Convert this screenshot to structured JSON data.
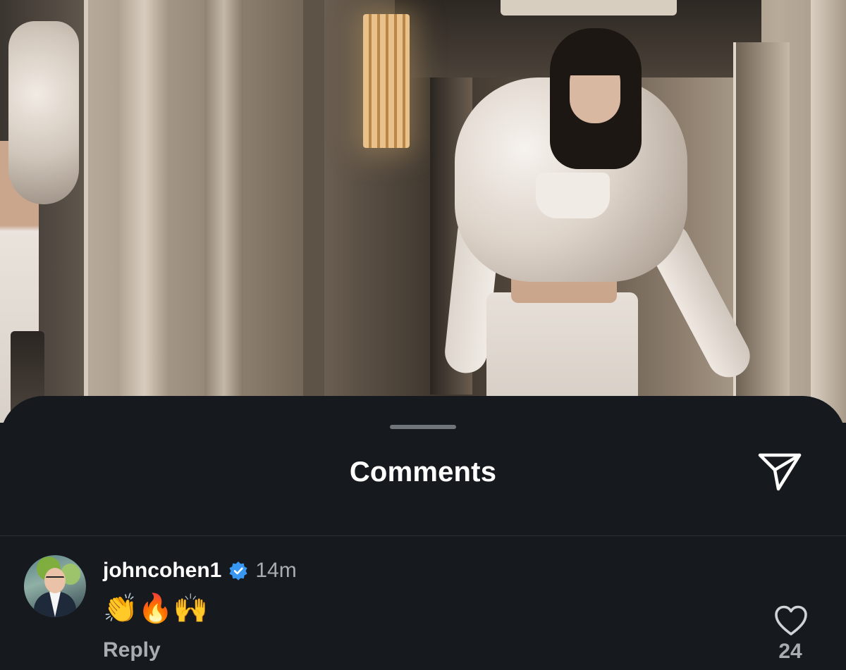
{
  "sheet": {
    "title": "Comments",
    "share_icon": "paper-plane-icon"
  },
  "comment": {
    "username": "johncohen1",
    "verified": true,
    "verified_color": "#3897f0",
    "time": "14m",
    "text": "👏🔥🙌",
    "reply_label": "Reply",
    "like_icon": "heart-outline-icon",
    "like_count": "24"
  },
  "colors": {
    "sheet_background": "#16191d",
    "primary_text": "#ffffff",
    "secondary_text": "#a8adb2"
  }
}
